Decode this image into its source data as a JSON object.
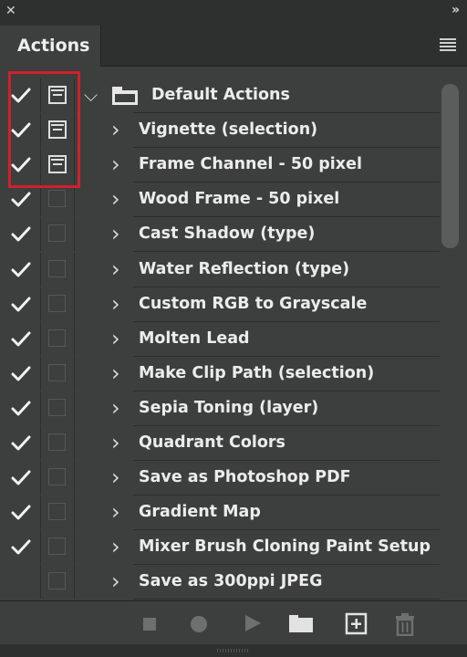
{
  "window": {
    "close_icon": "close-icon",
    "collapse_icon": "double-chevron-right-icon"
  },
  "panel": {
    "tab_label": "Actions",
    "menu_icon": "hamburger-menu-icon"
  },
  "actions": {
    "set": {
      "label": "Default Actions",
      "checked": true,
      "dialog": true,
      "expanded": true,
      "icon": "folder-icon"
    },
    "items": [
      {
        "label": "Vignette (selection)",
        "checked": true,
        "dialog": true
      },
      {
        "label": "Frame Channel - 50 pixel",
        "checked": true,
        "dialog": true
      },
      {
        "label": "Wood Frame - 50 pixel",
        "checked": true,
        "dialog": false
      },
      {
        "label": "Cast Shadow (type)",
        "checked": true,
        "dialog": false
      },
      {
        "label": "Water Reflection (type)",
        "checked": true,
        "dialog": false
      },
      {
        "label": "Custom RGB to Grayscale",
        "checked": true,
        "dialog": false
      },
      {
        "label": "Molten Lead",
        "checked": true,
        "dialog": false
      },
      {
        "label": "Make Clip Path (selection)",
        "checked": true,
        "dialog": false
      },
      {
        "label": "Sepia Toning (layer)",
        "checked": true,
        "dialog": false
      },
      {
        "label": "Quadrant Colors",
        "checked": true,
        "dialog": false
      },
      {
        "label": "Save as Photoshop PDF",
        "checked": true,
        "dialog": false
      },
      {
        "label": "Gradient Map",
        "checked": true,
        "dialog": false
      },
      {
        "label": "Mixer Brush Cloning Paint Setup",
        "checked": true,
        "dialog": false
      },
      {
        "label": "Save as 300ppi JPEG",
        "checked": false,
        "dialog": false
      }
    ]
  },
  "toolbar": {
    "buttons": [
      "stop-icon",
      "record-icon",
      "play-icon",
      "new-set-folder-icon",
      "new-action-icon",
      "trash-icon"
    ]
  },
  "colors": {
    "panel_bg": "#3d3e3e",
    "header_bg": "#2e2f2f",
    "highlight": "#d0212a",
    "text": "#ececec"
  }
}
